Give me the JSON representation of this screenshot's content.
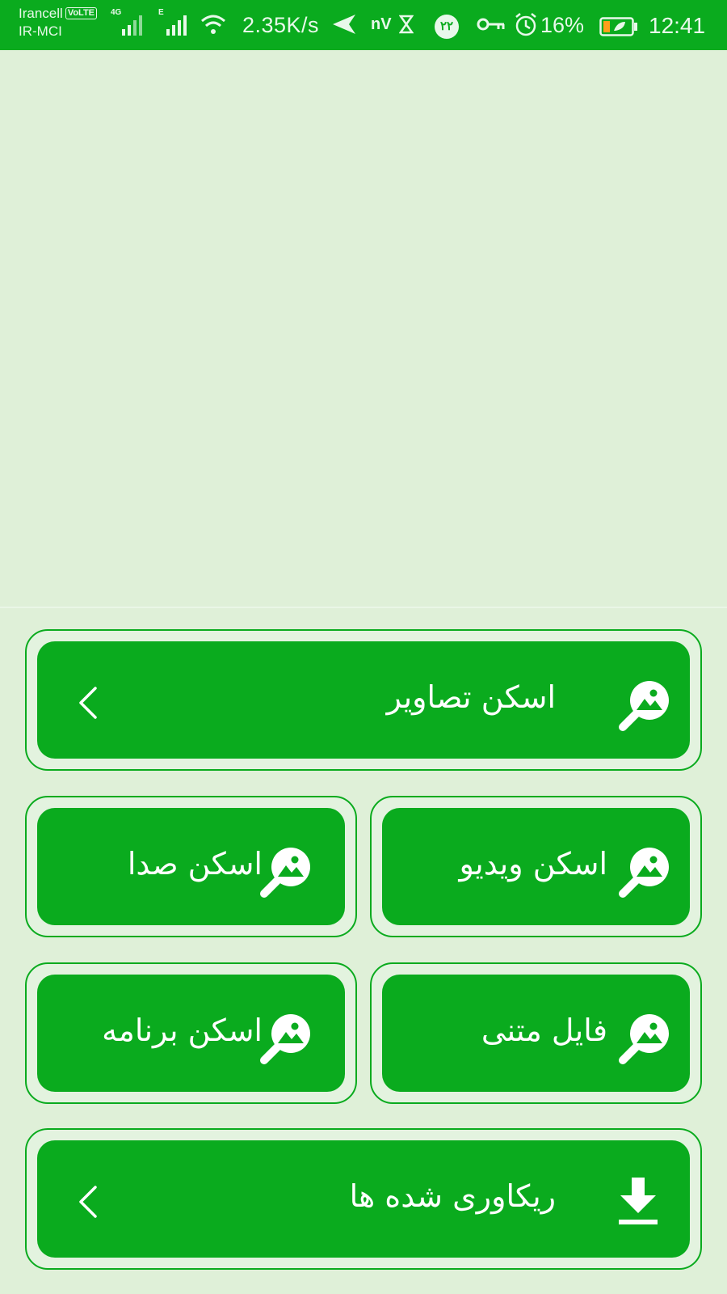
{
  "status_bar": {
    "carrier_1": "Irancell",
    "volte": "VoLTE",
    "carrier_2": "IR-MCI",
    "network_1": "4G",
    "network_2": "E",
    "speed": "2.35K/s",
    "nv": "nV",
    "notif_badge": "۲۲",
    "battery": "16%",
    "time": "12:41"
  },
  "actions": {
    "scan_images": {
      "label": "اسکن تصاویر",
      "icon": "search-image-icon"
    },
    "scan_video": {
      "label": "اسکن ویدیو",
      "icon": "search-image-icon"
    },
    "scan_audio": {
      "label": "اسکن صدا",
      "icon": "search-image-icon"
    },
    "text_file": {
      "label": "فایل متنی",
      "icon": "search-image-icon"
    },
    "scan_apps": {
      "label": "اسکن برنامه",
      "icon": "search-image-icon"
    },
    "recovered": {
      "label": "ریکاوری شده ها",
      "icon": "download-icon"
    }
  },
  "colors": {
    "accent": "#0aab1e",
    "background": "#dff0d8"
  }
}
